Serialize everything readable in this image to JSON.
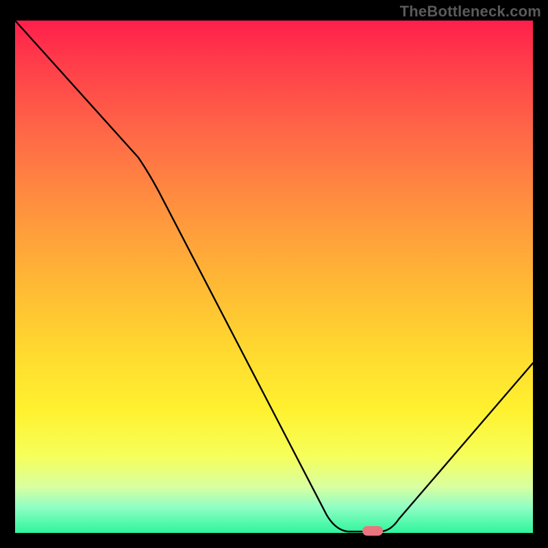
{
  "watermark": "TheBottleneck.com",
  "colors": {
    "page_bg": "#000000",
    "watermark": "#5a5a5a",
    "curve": "#000000",
    "marker": "#e9757f",
    "gradient_top": "#ff1f4b",
    "gradient_bottom": "#2ef59c"
  },
  "chart_data": {
    "type": "line",
    "title": "",
    "xlabel": "",
    "ylabel": "",
    "xlim": [
      0,
      100
    ],
    "ylim": [
      0,
      100
    ],
    "x": [
      0,
      25,
      62,
      67,
      70,
      100
    ],
    "values": [
      100,
      72,
      2,
      0,
      0,
      32
    ],
    "marker": {
      "x": 69,
      "y": 0
    },
    "notes": "V-shaped bottleneck curve. y=0 is optimal (green), y=100 is worst (red). Values estimated from pixel positions against the gradient background; no axis ticks or labels are rendered in the image."
  }
}
